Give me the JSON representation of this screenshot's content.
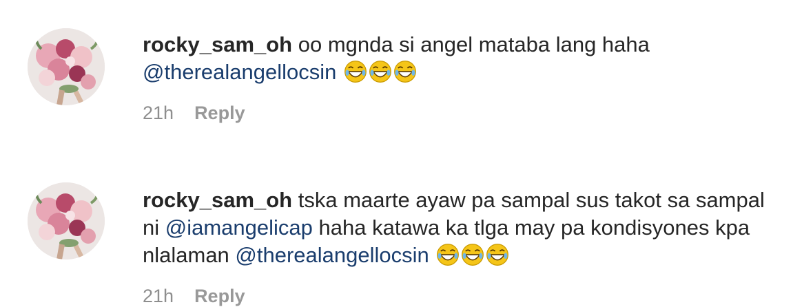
{
  "comments": [
    {
      "username": "rocky_sam_oh",
      "text_1": " oo mgnda si angel mataba lang haha ",
      "mention_1": "@therealangellocsin",
      "emojis": [
        "laughing-emoji",
        "laughing-emoji",
        "laughing-emoji"
      ],
      "time": "21h",
      "reply_label": "Reply"
    },
    {
      "username": "rocky_sam_oh",
      "text_1": " tska maarte ayaw pa sampal sus takot sa sampal ni ",
      "mention_1": "@iamangelicap",
      "text_2": " haha katawa ka tlga may pa kondisyones kpa nlalaman ",
      "mention_2": "@therealangellocsin",
      "emojis": [
        "laughing-emoji",
        "laughing-emoji",
        "laughing-emoji"
      ],
      "time": "21h",
      "reply_label": "Reply"
    }
  ],
  "colors": {
    "text": "#262626",
    "mention": "#1a3d6d",
    "meta": "#8e8e8e"
  }
}
